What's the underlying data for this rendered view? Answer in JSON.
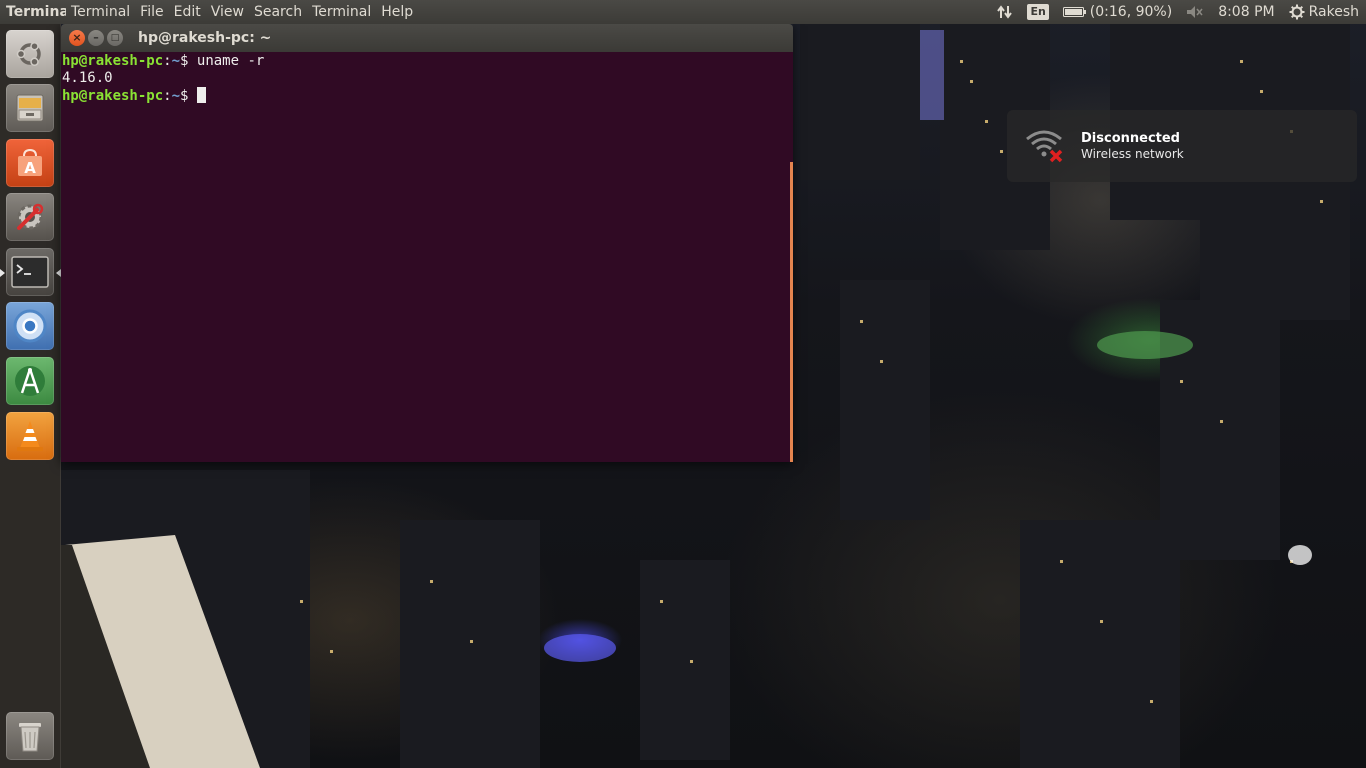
{
  "top_panel": {
    "app_name": "Terminal",
    "menu": [
      "Terminal",
      "File",
      "Edit",
      "View",
      "Search",
      "Terminal",
      "Help"
    ],
    "indicators": {
      "network_icon": "network-arrows-icon",
      "keyboard_layout": "En",
      "battery_text": "(0:16, 90%)",
      "volume_icon": "volume-muted-icon",
      "clock": "8:08 PM",
      "user_name": "Rakesh"
    }
  },
  "launcher": {
    "items": [
      {
        "name": "ubuntu-dash",
        "icon": "ubuntu-logo-icon"
      },
      {
        "name": "files",
        "icon": "file-cabinet-icon"
      },
      {
        "name": "software-center",
        "icon": "shopping-bag-icon"
      },
      {
        "name": "system-settings",
        "icon": "wrench-gear-icon"
      },
      {
        "name": "terminal",
        "icon": "terminal-icon"
      },
      {
        "name": "chromium",
        "icon": "chromium-icon"
      },
      {
        "name": "android-studio",
        "icon": "android-studio-icon"
      },
      {
        "name": "vlc",
        "icon": "traffic-cone-icon"
      },
      {
        "name": "trash",
        "icon": "trash-icon"
      }
    ]
  },
  "terminal": {
    "title": "hp@rakesh-pc: ~",
    "lines": [
      {
        "user": "hp@rakesh-pc",
        "sep": ":",
        "path": "~",
        "prompt": "$ ",
        "command": "uname -r"
      },
      {
        "output": "4.16.0"
      },
      {
        "user": "hp@rakesh-pc",
        "sep": ":",
        "path": "~",
        "prompt": "$ ",
        "command": ""
      }
    ],
    "background_color": "#300a24"
  },
  "notification": {
    "icon": "wifi-disconnected-icon",
    "title": "Disconnected",
    "body": "Wireless network"
  },
  "colors": {
    "panel": "#3c3b37",
    "prompt_user": "#8ae234",
    "prompt_path": "#729fcf",
    "close_button": "#e0531f"
  }
}
